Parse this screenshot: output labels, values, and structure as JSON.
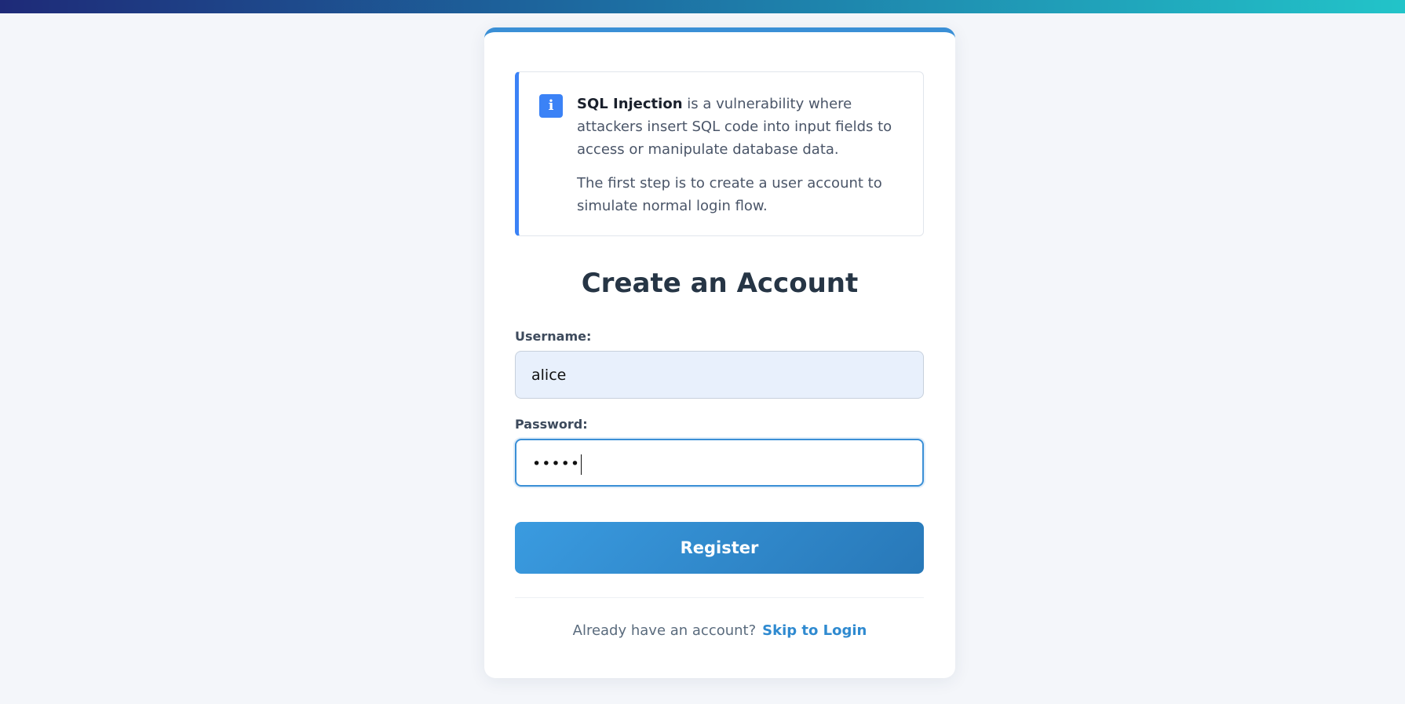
{
  "colors": {
    "accent": "#3a8fd6",
    "info_accent": "#3b82f6",
    "button_start": "#3a9be0",
    "button_end": "#2878b8",
    "link": "#2f8ad0",
    "background": "#f4f6fa"
  },
  "info": {
    "icon": "info-icon",
    "icon_glyph": "i",
    "term": "SQL Injection",
    "text1": " is a vulnerability where attackers insert SQL code into input fields to access or manipulate database data.",
    "text2": "The first step is to create a user account to simulate normal login flow."
  },
  "form": {
    "title": "Create an Account",
    "username": {
      "label": "Username:",
      "value": "alice"
    },
    "password": {
      "label": "Password:",
      "masked_value": "•••••"
    },
    "register_label": "Register"
  },
  "footer": {
    "prompt": "Already have an account?",
    "link_label": "Skip to Login"
  }
}
